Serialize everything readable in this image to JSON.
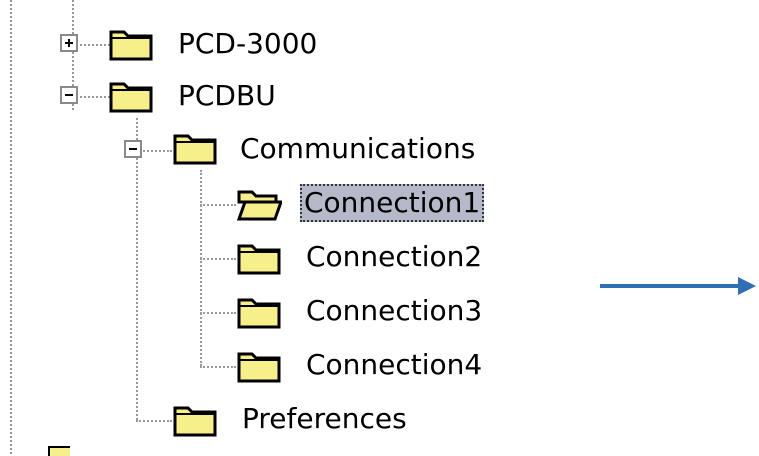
{
  "tree": {
    "nodes": [
      {
        "id": "pcd3000",
        "label": "PCD-3000",
        "expander": "+",
        "state": "collapsed"
      },
      {
        "id": "pcdbu",
        "label": "PCDBU",
        "expander": "−",
        "state": "expanded"
      },
      {
        "id": "communications",
        "label": "Communications",
        "expander": "−",
        "state": "expanded"
      },
      {
        "id": "connection1",
        "label": "Connection1",
        "selected": true,
        "icon": "open-folder-icon"
      },
      {
        "id": "connection2",
        "label": "Connection2",
        "icon": "folder-icon"
      },
      {
        "id": "connection3",
        "label": "Connection3",
        "icon": "folder-icon"
      },
      {
        "id": "connection4",
        "label": "Connection4",
        "icon": "folder-icon"
      },
      {
        "id": "preferences",
        "label": "Preferences",
        "icon": "folder-icon"
      }
    ]
  },
  "colors": {
    "folder_fill": "#f7f08a",
    "folder_outline": "#000000",
    "selection_bg": "#b5b9c9",
    "arrow": "#2f6fb4",
    "dotted_line": "#9a9a9a"
  },
  "decor": {
    "arrow_icon": "right-arrow-icon"
  }
}
